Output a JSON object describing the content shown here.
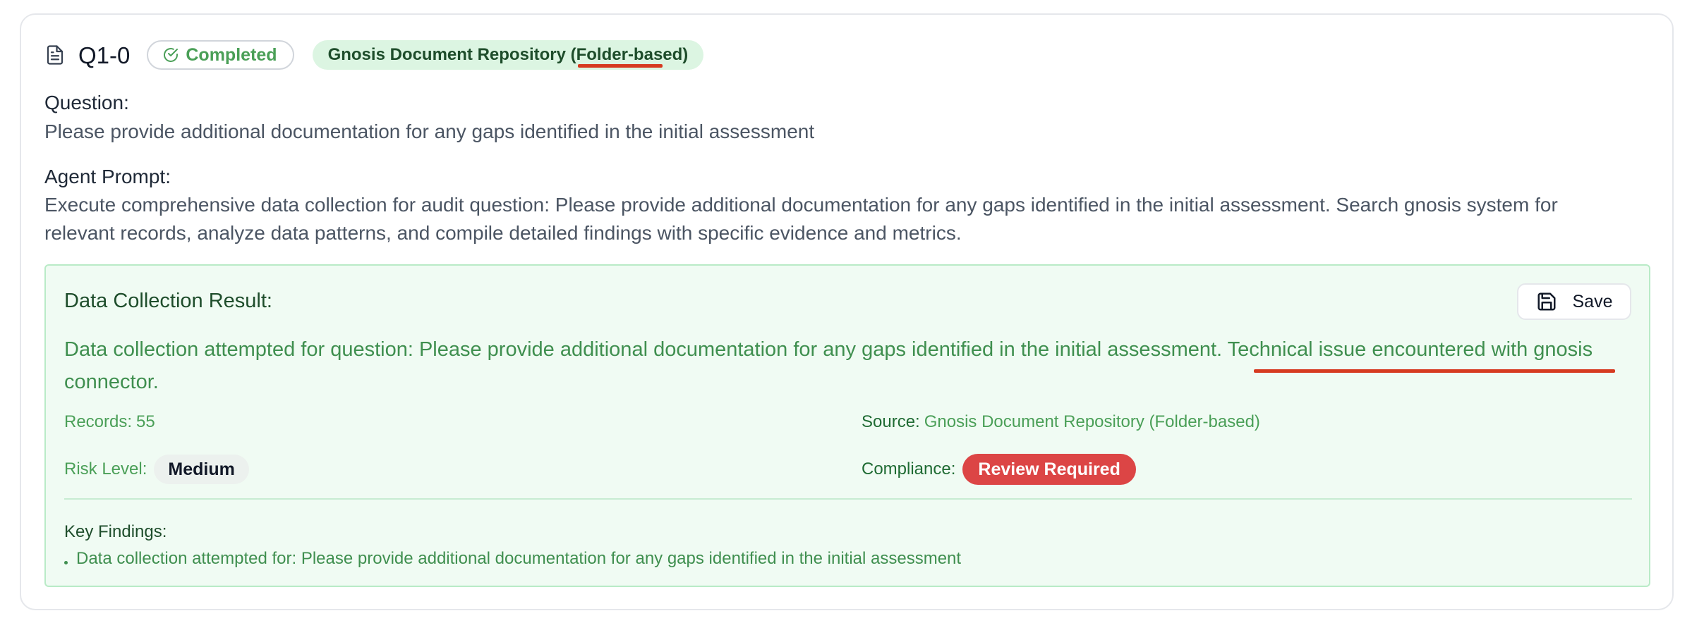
{
  "header": {
    "question_id": "Q1-0",
    "status": "Completed",
    "source_badge": "Gnosis Document Repository (Folder-based)"
  },
  "question": {
    "label": "Question:",
    "text": "Please provide additional documentation for any gaps identified in the initial assessment"
  },
  "agent_prompt": {
    "label": "Agent Prompt:",
    "line1": "Execute comprehensive data collection for audit question: Please provide additional documentation for any gaps identified in the initial assessment. Search gnosis system for",
    "line2": "relevant records, analyze data patterns, and compile detailed findings with specific evidence and metrics."
  },
  "result": {
    "title": "Data Collection Result:",
    "save_label": "Save",
    "text_part1": "Data collection attempted for question: Please provide additional documentation for any gaps identified in the initial assessment. ",
    "text_part2": "Technical issue encountered with gnosis",
    "text_part3": "connector.",
    "records_label": "Records:",
    "records_value": "55",
    "source_label": "Source:",
    "source_value": "Gnosis Document Repository (Folder-based)",
    "risk_label": "Risk Level:",
    "risk_value": "Medium",
    "compliance_label": "Compliance:",
    "compliance_value": "Review Required",
    "findings_label": "Key Findings:",
    "findings": [
      "Data collection attempted for: Please provide additional documentation for any gaps identified in the initial assessment"
    ]
  },
  "colors": {
    "success_green": "#4a9f57",
    "result_bg": "#f0fbf3",
    "compliance_red": "#dc4545",
    "annotation_red": "#d63a20"
  },
  "icons": [
    "document-icon",
    "check-circle-icon",
    "save-icon"
  ]
}
